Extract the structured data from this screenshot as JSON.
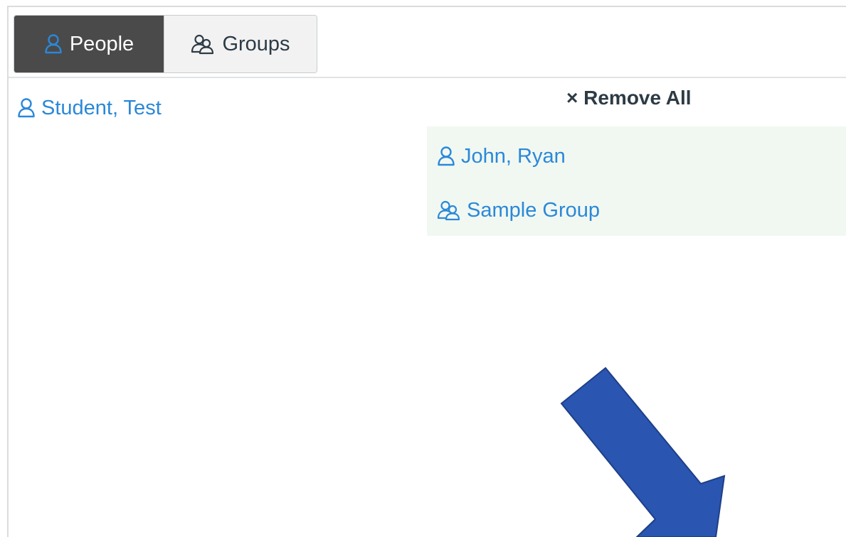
{
  "tabs": {
    "people_label": "People",
    "groups_label": "Groups"
  },
  "available": {
    "items": [
      {
        "label": "Student, Test",
        "icon": "person-icon"
      }
    ]
  },
  "selected": {
    "remove_all_label": "× Remove All",
    "items": [
      {
        "label": "John, Ryan",
        "icon": "person-icon"
      },
      {
        "label": "Sample Group",
        "icon": "group-icon"
      }
    ]
  },
  "colors": {
    "link": "#2b88d8",
    "active_tab_bg": "#4a4a4a",
    "selected_panel_bg": "#f1f8f2",
    "arrow": "#2a55b0"
  }
}
